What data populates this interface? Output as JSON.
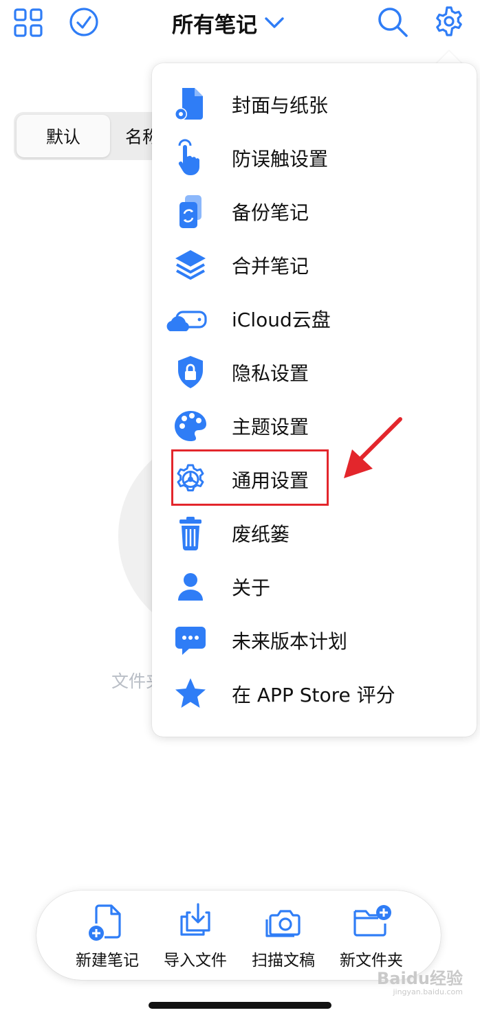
{
  "colors": {
    "accent": "#2f7df6",
    "highlight": "#e3262c"
  },
  "header": {
    "title": "所有笔记",
    "left_icons": [
      "grid-icon",
      "check-circle-icon"
    ],
    "right_icons": [
      "search-icon",
      "gear-icon"
    ]
  },
  "sort_segment": {
    "default_label": "默认",
    "name_label": "名称"
  },
  "empty_state": {
    "text": "文件夹"
  },
  "menu": {
    "items": [
      {
        "label": "封面与纸张",
        "icon": "paper-settings-icon"
      },
      {
        "label": "防误触设置",
        "icon": "touch-hand-icon"
      },
      {
        "label": "备份笔记",
        "icon": "backup-phone-icon"
      },
      {
        "label": "合并笔记",
        "icon": "layers-icon"
      },
      {
        "label": "iCloud云盘",
        "icon": "icloud-drive-icon"
      },
      {
        "label": "隐私设置",
        "icon": "shield-lock-icon"
      },
      {
        "label": "主题设置",
        "icon": "palette-icon"
      },
      {
        "label": "通用设置",
        "icon": "general-gear-icon"
      },
      {
        "label": "废纸篓",
        "icon": "trash-icon"
      },
      {
        "label": "关于",
        "icon": "person-icon"
      },
      {
        "label": "未来版本计划",
        "icon": "chat-bubble-icon"
      },
      {
        "label": "在 APP Store 评分",
        "icon": "star-icon"
      }
    ]
  },
  "toolbar": {
    "items": [
      {
        "label": "新建笔记",
        "icon": "new-note-icon"
      },
      {
        "label": "导入文件",
        "icon": "import-file-icon"
      },
      {
        "label": "扫描文稿",
        "icon": "camera-scan-icon"
      },
      {
        "label": "新文件夹",
        "icon": "new-folder-icon"
      }
    ]
  },
  "watermark": {
    "text": "Bai",
    "suffix": "du经验",
    "sub": "jingyan.baidu.com"
  }
}
